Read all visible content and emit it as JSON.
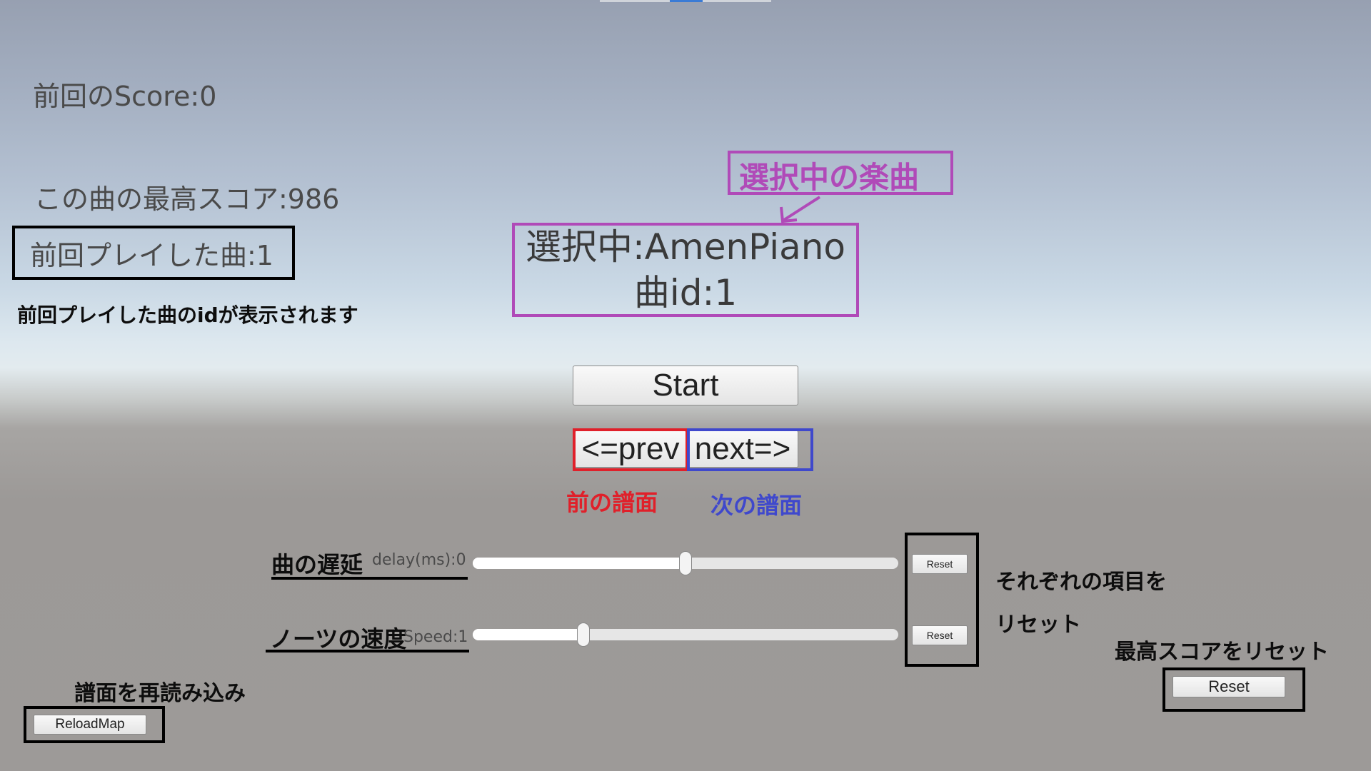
{
  "colors": {
    "annotation_black": "#000000",
    "annotation_purple": "#b04ab8",
    "annotation_red": "#e0202a",
    "annotation_blue": "#3f48cc"
  },
  "game": {
    "last_score": "前回のScore:0",
    "best_score": "この曲の最高スコア:986",
    "last_played": "前回プレイした曲:1",
    "selected_title": "選択中:AmenPiano",
    "selected_id": "曲id:1",
    "start_label": "Start",
    "prev_label": "<=prev",
    "next_label": "next=>",
    "delay_value": "delay(ms):0",
    "speed_value": "Speed:1",
    "delay_reset": "Reset",
    "speed_reset": "Reset",
    "reload_label": "ReloadMap",
    "score_reset": "Reset",
    "delay_slider_fraction": 0.5,
    "speed_slider_fraction": 0.26
  },
  "annotations": {
    "selected_song": "選択中の楽曲",
    "last_played_desc": "前回プレイした曲のidが表示されます",
    "prev_desc": "前の譜面",
    "next_desc": "次の譜面",
    "delay_label": "曲の遅延",
    "speed_label": "ノーツの速度",
    "reset_each_line1": "それぞれの項目を",
    "reset_each_line2": "リセット",
    "reset_best_score": "最高スコアをリセット",
    "reload_desc": "譜面を再読み込み"
  }
}
